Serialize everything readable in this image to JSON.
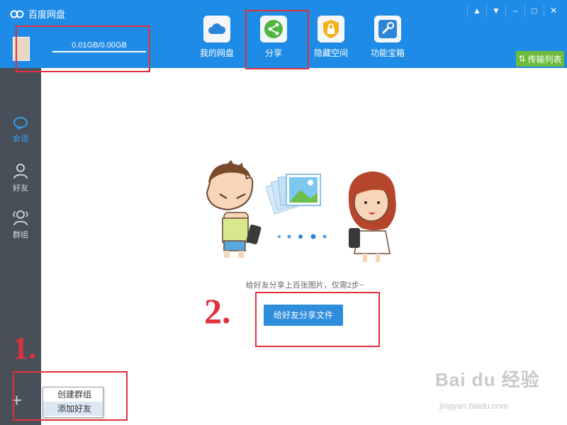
{
  "app": {
    "title": "百度网盘"
  },
  "user": {
    "quota": "0.01GB/0.00GB"
  },
  "nav": [
    {
      "label": "我的网盘",
      "icon": "cloud-icon"
    },
    {
      "label": "分享",
      "icon": "share-icon",
      "active": true
    },
    {
      "label": "隐藏空间",
      "icon": "lock-icon"
    },
    {
      "label": "功能宝箱",
      "icon": "toolbox-icon"
    }
  ],
  "window_controls": [
    "bell-icon",
    "dropdown-icon",
    "minimize-icon",
    "maximize-icon",
    "close-icon"
  ],
  "transfer_list": {
    "label": "传输列表"
  },
  "sidebar": [
    {
      "label": "会话",
      "icon": "chat-icon",
      "active": true
    },
    {
      "label": "好友",
      "icon": "friend-icon"
    },
    {
      "label": "群组",
      "icon": "group-icon"
    }
  ],
  "context_menu": [
    "创建群组",
    "添加好友"
  ],
  "main": {
    "hint": "给好友分享上百张图片，仅需2步~",
    "share_button": "给好友分享文件"
  },
  "annotations": {
    "step1": "1.",
    "step2": "2."
  },
  "watermark": {
    "text": "Bai du 经验",
    "url": "jingyan.baidu.com"
  },
  "colors": {
    "topbar": "#1e8be6",
    "sidebar": "#484f59",
    "annotation": "#e0303a",
    "transfer": "#6cbb3c",
    "share_button": "#2e8ddc"
  }
}
